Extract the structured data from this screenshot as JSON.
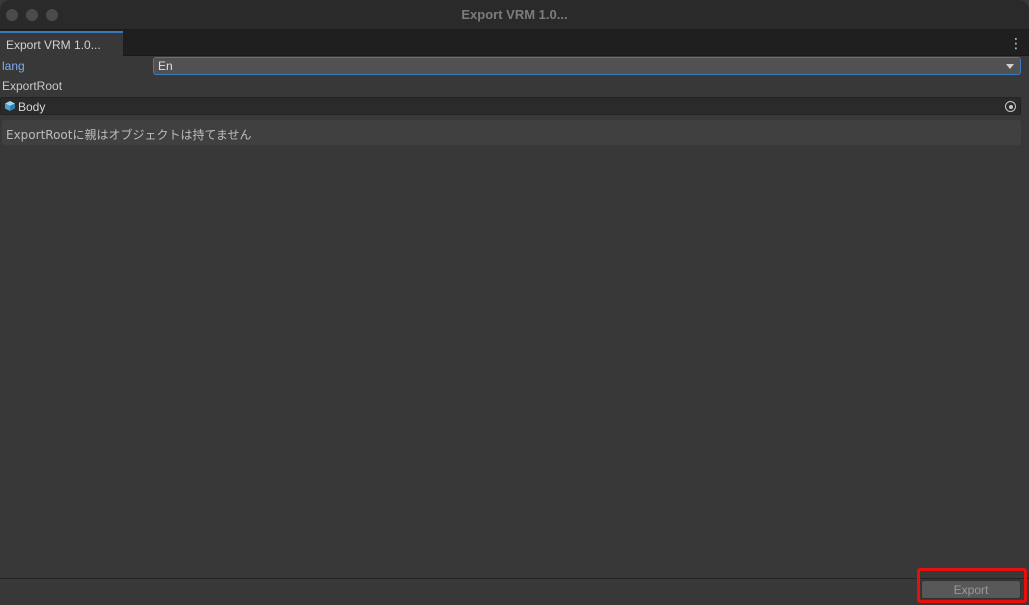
{
  "window": {
    "title": "Export VRM 1.0..."
  },
  "tabs": [
    {
      "label": "Export VRM 1.0..."
    }
  ],
  "menu": {
    "icon": "more-vertical-icon",
    "glyph": "⋮"
  },
  "lang": {
    "label": "lang",
    "value": "En"
  },
  "export_root": {
    "label": "ExportRoot",
    "object_name": "Body",
    "object_icon": "prefab-cube-icon",
    "picker_icon": "object-picker-icon"
  },
  "help": {
    "message": "ExportRootに親はオブジェクトは持てません"
  },
  "footer": {
    "export_label": "Export"
  },
  "colors": {
    "accent": "#3a79bb",
    "highlight": "#e8100c",
    "label_blue": "#7bacf0",
    "background": "#383838"
  }
}
